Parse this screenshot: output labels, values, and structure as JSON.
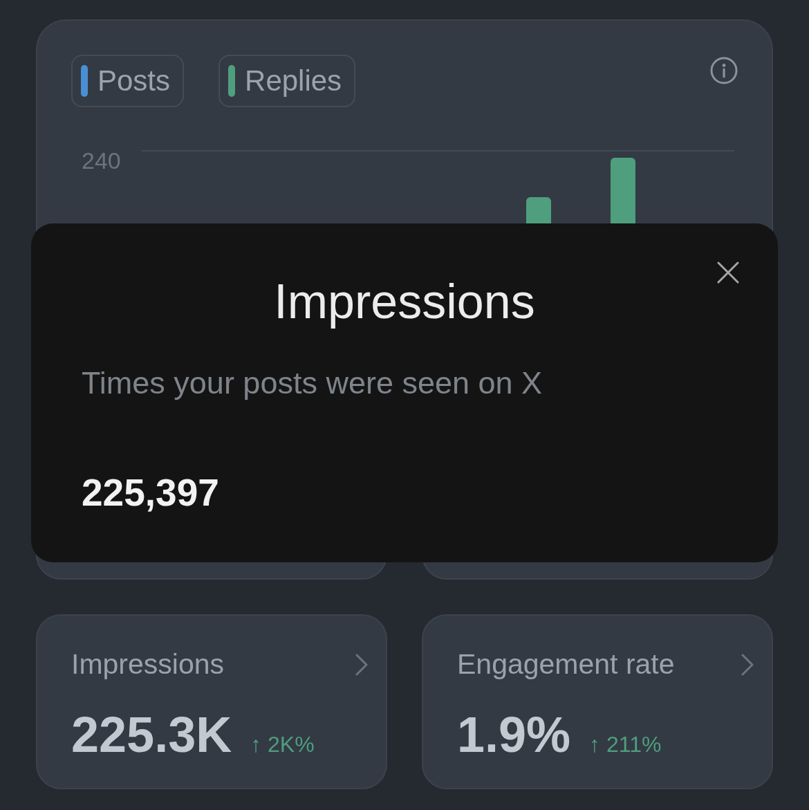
{
  "chart_card": {
    "legend": [
      {
        "label": "Posts",
        "color": "#4a8fd4"
      },
      {
        "label": "Replies",
        "color": "#4f9e7e"
      }
    ],
    "y_tick_label": "240"
  },
  "popup": {
    "title": "Impressions",
    "description": "Times your posts were seen on X",
    "value": "225,397"
  },
  "stat_cards": [
    {
      "title": "Impressions",
      "value": "225.3K",
      "change": "↑ 2K%"
    },
    {
      "title": "Engagement rate",
      "value": "1.9%",
      "change": "↑ 211%"
    }
  ]
}
